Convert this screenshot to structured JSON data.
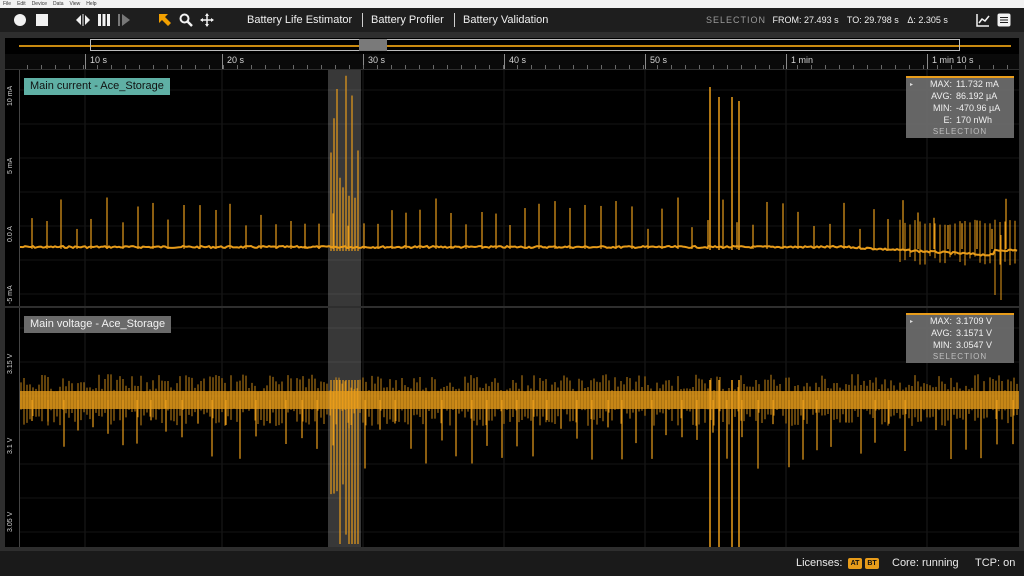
{
  "menubar": [
    "File",
    "Edit",
    "Device",
    "Data",
    "View",
    "Help"
  ],
  "toolbar": {
    "icons": [
      "record-icon",
      "stop-icon",
      "fit-horizontal-icon",
      "pause-icon",
      "play-icon",
      "pointer-icon",
      "zoom-icon",
      "pan-icon",
      "chart-view-icon",
      "menu-icon"
    ],
    "nav": [
      "Battery Life Estimator",
      "Battery Profiler",
      "Battery Validation"
    ]
  },
  "selection": {
    "label": "SELECTION",
    "from_label": "FROM:",
    "from": "27.493 s",
    "to_label": "TO:",
    "to": "29.798 s",
    "delta_label": "Δ:",
    "delta": "2.305 s"
  },
  "timeaxis": {
    "ticks": [
      "10 s",
      "20 s",
      "30 s",
      "40 s",
      "50 s",
      "1 min",
      "1 min 10 s"
    ]
  },
  "current_pane": {
    "title": "Main current - Ace_Storage",
    "y_labels": [
      "10 mA",
      "5 mA",
      "0.0 A",
      "-5 mA"
    ],
    "stats": {
      "max_label": "MAX:",
      "max": "11.732 mA",
      "avg_label": "AVG:",
      "avg": "86.192 µA",
      "min_label": "MIN:",
      "min": "-470.96 µA",
      "e_label": "E:",
      "e": "170 nWh",
      "footer": "SELECTION"
    }
  },
  "voltage_pane": {
    "title": "Main voltage - Ace_Storage",
    "y_labels": [
      "3.15 V",
      "3.1 V",
      "3.05 V"
    ],
    "stats": {
      "max_label": "MAX:",
      "max": "3.1709 V",
      "avg_label": "AVG:",
      "avg": "3.1571 V",
      "min_label": "MIN:",
      "min": "3.0547 V",
      "footer": "SELECTION"
    }
  },
  "statusbar": {
    "licenses_label": "Licenses:",
    "badges": [
      "AT",
      "BT"
    ],
    "core": "Core: running",
    "tcp": "TCP: on"
  },
  "colors": {
    "trace": "#e89c1a",
    "current_title_bg": "#5fb0a5",
    "voltage_title_bg": "#6a6a6a"
  }
}
